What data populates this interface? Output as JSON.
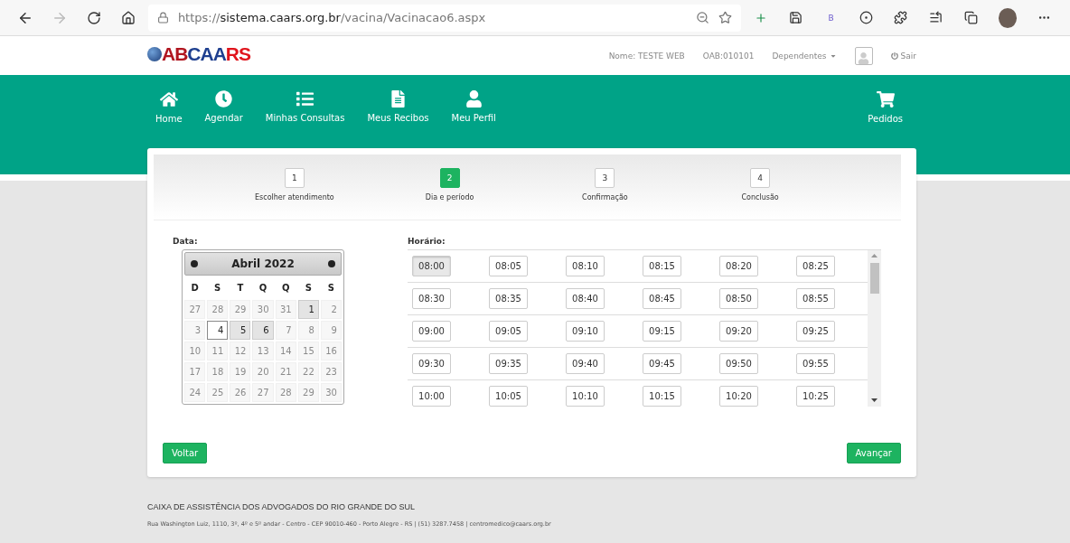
{
  "browser": {
    "scheme": "https://",
    "host": "sistema.caars.org.br",
    "path": "/vacina/Vacinacao6.aspx",
    "extension_label": "B"
  },
  "header": {
    "logo": {
      "part_a": "AB",
      "part_b": "CAA",
      "part_c": "RS"
    },
    "user_name": "Nome: TESTE WEB",
    "oab": "OAB:010101",
    "dependents": "Dependentes",
    "logout": "Sair"
  },
  "nav": [
    {
      "kind": "home",
      "label": "Home"
    },
    {
      "kind": "clock",
      "label": "Agendar"
    },
    {
      "kind": "list",
      "label": "Minhas Consultas"
    },
    {
      "kind": "file",
      "label": "Meus Recibos"
    },
    {
      "kind": "user",
      "label": "Meu Perfil"
    }
  ],
  "nav_right": {
    "kind": "cart",
    "label": "Pedidos"
  },
  "steps": [
    {
      "number": "1",
      "label": "Escolher atendimento",
      "selected": false
    },
    {
      "number": "2",
      "label": "Dia e período",
      "selected": true
    },
    {
      "number": "3",
      "label": "Confirmação",
      "selected": false
    },
    {
      "number": "4",
      "label": "Conclusão",
      "selected": false
    }
  ],
  "date_label": "Data:",
  "calendar": {
    "title": "Abril 2022",
    "weekdays": [
      "D",
      "S",
      "T",
      "Q",
      "Q",
      "S",
      "S"
    ],
    "weeks": [
      [
        {
          "day": "27",
          "available": false,
          "today": false
        },
        {
          "day": "28",
          "available": false,
          "today": false
        },
        {
          "day": "29",
          "available": false,
          "today": false
        },
        {
          "day": "30",
          "available": false,
          "today": false
        },
        {
          "day": "31",
          "available": false,
          "today": false
        },
        {
          "day": "1",
          "available": true,
          "today": false
        },
        {
          "day": "2",
          "available": false,
          "today": false
        }
      ],
      [
        {
          "day": "3",
          "available": false,
          "today": false
        },
        {
          "day": "4",
          "available": true,
          "today": true
        },
        {
          "day": "5",
          "available": true,
          "today": false
        },
        {
          "day": "6",
          "available": true,
          "today": false
        },
        {
          "day": "7",
          "available": false,
          "today": false
        },
        {
          "day": "8",
          "available": false,
          "today": false
        },
        {
          "day": "9",
          "available": false,
          "today": false
        }
      ],
      [
        {
          "day": "10",
          "available": false,
          "today": false
        },
        {
          "day": "11",
          "available": false,
          "today": false
        },
        {
          "day": "12",
          "available": false,
          "today": false
        },
        {
          "day": "13",
          "available": false,
          "today": false
        },
        {
          "day": "14",
          "available": false,
          "today": false
        },
        {
          "day": "15",
          "available": false,
          "today": false
        },
        {
          "day": "16",
          "available": false,
          "today": false
        }
      ],
      [
        {
          "day": "17",
          "available": false,
          "today": false
        },
        {
          "day": "18",
          "available": false,
          "today": false
        },
        {
          "day": "19",
          "available": false,
          "today": false
        },
        {
          "day": "20",
          "available": false,
          "today": false
        },
        {
          "day": "21",
          "available": false,
          "today": false
        },
        {
          "day": "22",
          "available": false,
          "today": false
        },
        {
          "day": "23",
          "available": false,
          "today": false
        }
      ],
      [
        {
          "day": "24",
          "available": false,
          "today": false
        },
        {
          "day": "25",
          "available": false,
          "today": false
        },
        {
          "day": "26",
          "available": false,
          "today": false
        },
        {
          "day": "27",
          "available": false,
          "today": false
        },
        {
          "day": "28",
          "available": false,
          "today": false
        },
        {
          "day": "29",
          "available": false,
          "today": false
        },
        {
          "day": "30",
          "available": false,
          "today": false
        }
      ]
    ]
  },
  "time_label": "Horário:",
  "time_rows": [
    [
      {
        "label": "08:00",
        "selected": true
      },
      {
        "label": "08:05",
        "selected": false
      },
      {
        "label": "08:10",
        "selected": false
      },
      {
        "label": "08:15",
        "selected": false
      },
      {
        "label": "08:20",
        "selected": false
      },
      {
        "label": "08:25",
        "selected": false
      }
    ],
    [
      {
        "label": "08:30",
        "selected": false
      },
      {
        "label": "08:35",
        "selected": false
      },
      {
        "label": "08:40",
        "selected": false
      },
      {
        "label": "08:45",
        "selected": false
      },
      {
        "label": "08:50",
        "selected": false
      },
      {
        "label": "08:55",
        "selected": false
      }
    ],
    [
      {
        "label": "09:00",
        "selected": false
      },
      {
        "label": "09:05",
        "selected": false
      },
      {
        "label": "09:10",
        "selected": false
      },
      {
        "label": "09:15",
        "selected": false
      },
      {
        "label": "09:20",
        "selected": false
      },
      {
        "label": "09:25",
        "selected": false
      }
    ],
    [
      {
        "label": "09:30",
        "selected": false
      },
      {
        "label": "09:35",
        "selected": false
      },
      {
        "label": "09:40",
        "selected": false
      },
      {
        "label": "09:45",
        "selected": false
      },
      {
        "label": "09:50",
        "selected": false
      },
      {
        "label": "09:55",
        "selected": false
      }
    ],
    [
      {
        "label": "10:00",
        "selected": false
      },
      {
        "label": "10:05",
        "selected": false
      },
      {
        "label": "10:10",
        "selected": false
      },
      {
        "label": "10:15",
        "selected": false
      },
      {
        "label": "10:20",
        "selected": false
      },
      {
        "label": "10:25",
        "selected": false
      }
    ]
  ],
  "buttons": {
    "back": "Voltar",
    "next": "Avançar"
  },
  "footer": {
    "title": "CAIXA DE ASSISTÊNCIA DOS ADVOGADOS DO RIO GRANDE DO SUL",
    "address": "Rua Washington Luiz, 1110, 3º, 4º e 5º andar - Centro - CEP 90010-460 - Porto Alegre - RS | (51) 3287.7458 | centromedico@caars.org.br"
  }
}
